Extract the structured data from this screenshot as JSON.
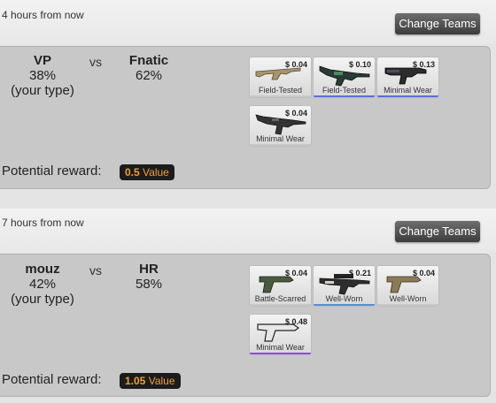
{
  "matches": [
    {
      "time": "4 hours from now",
      "change_label": "Change Teams",
      "team1": {
        "name": "VP",
        "pct": "38%",
        "note": "(your type)"
      },
      "vs": "vs",
      "team2": {
        "name": "Fnatic",
        "pct": "62%"
      },
      "reward_label": "Potential reward:",
      "reward_value": "0.5",
      "reward_unit": "Value",
      "items": [
        {
          "price": "$ 0.04",
          "condition": "Field-Tested",
          "icon": "rifle-icon",
          "accent": "#c8c8c8"
        },
        {
          "price": "$ 0.10",
          "condition": "Field-Tested",
          "icon": "machine-gun-icon",
          "accent": "#5a6ee0"
        },
        {
          "price": "$ 0.13",
          "condition": "Minimal Wear",
          "icon": "smg-icon",
          "accent": "#5a6ee0"
        },
        {
          "price": "$ 0.04",
          "condition": "Minimal Wear",
          "icon": "assault-rifle-icon",
          "accent": "#c8c8c8"
        }
      ]
    },
    {
      "time": "7 hours from now",
      "change_label": "Change Teams",
      "team1": {
        "name": "mouz",
        "pct": "42%",
        "note": "(your type)"
      },
      "vs": "vs",
      "team2": {
        "name": "HR",
        "pct": "58%"
      },
      "reward_label": "Potential reward:",
      "reward_value": "1.05",
      "reward_unit": "Value",
      "items": [
        {
          "price": "$ 0.04",
          "condition": "Battle-Scarred",
          "icon": "pistol-icon",
          "accent": "#c8c8c8"
        },
        {
          "price": "$ 0.21",
          "condition": "Well-Worn",
          "icon": "scoped-rifle-icon",
          "accent": "#5a8ed8"
        },
        {
          "price": "$ 0.04",
          "condition": "Well-Worn",
          "icon": "pistol-icon",
          "accent": "#c8c8c8"
        },
        {
          "price": "$ 0.48",
          "condition": "Minimal Wear",
          "icon": "pistol-icon",
          "accent": "#8a4ee0"
        }
      ]
    }
  ]
}
